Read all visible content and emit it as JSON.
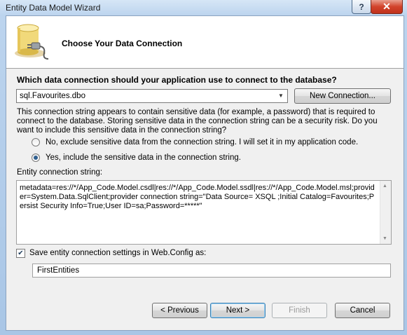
{
  "window": {
    "title": "Entity Data Model Wizard",
    "help_label": "?",
    "close_label": "✕"
  },
  "header": {
    "title": "Choose Your Data Connection",
    "icon": "database-connection-icon"
  },
  "question": "Which data connection should your application use to connect to the database?",
  "connection": {
    "selected": "sql.Favourites.dbo",
    "dropdown_icon": "chevron-down-icon",
    "new_button_label": "New Connection..."
  },
  "warning": "This connection string appears to contain sensitive data (for example, a password) that is required to connect to the database. Storing sensitive data in the connection string can be a security risk. Do you want to include this sensitive data in the connection string?",
  "options": {
    "exclude_label": "No, exclude sensitive data from the connection string. I will set it in my application code.",
    "include_label": "Yes, include the sensitive data in the connection string.",
    "selected": "include"
  },
  "entity_connection": {
    "label": "Entity connection string:",
    "value": "metadata=res://*/App_Code.Model.csdl|res://*/App_Code.Model.ssdl|res://*/App_Code.Model.msl;provider=System.Data.SqlClient;provider connection string=\"Data Source= XSQL ;Initial Catalog=Favourites;Persist Security Info=True;User ID=sa;Password=*****\""
  },
  "save_settings": {
    "checked": true,
    "label": "Save entity connection settings in Web.Config as:",
    "value": "FirstEntities"
  },
  "footer": {
    "previous_label": "< Previous",
    "next_label": "Next >",
    "finish_label": "Finish",
    "cancel_label": "Cancel"
  },
  "colors": {
    "frame": "#bcd4ee",
    "client": "#f0f0f0",
    "close_button": "#d2432b"
  }
}
